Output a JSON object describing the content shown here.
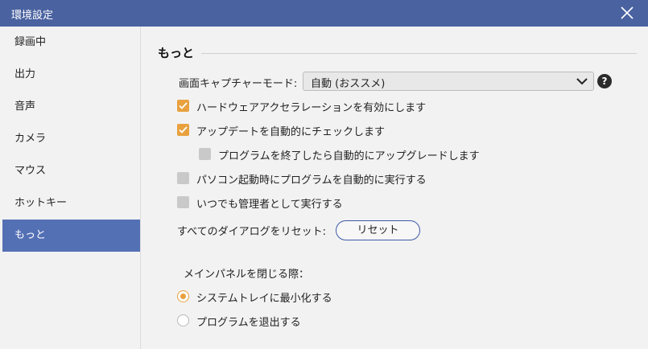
{
  "window": {
    "title": "環境設定"
  },
  "sidebar": {
    "items": [
      {
        "label": "録画中"
      },
      {
        "label": "出力"
      },
      {
        "label": "音声"
      },
      {
        "label": "カメラ"
      },
      {
        "label": "マウス"
      },
      {
        "label": "ホットキー"
      },
      {
        "label": "もっと",
        "active": true
      }
    ]
  },
  "main": {
    "section_title": "もっと",
    "capture_mode": {
      "label": "画面キャプチャーモード:",
      "value": "自動 (おススメ)",
      "help": "?"
    },
    "options": [
      {
        "label": "ハードウェアアクセラレーションを有効にします",
        "checked": true
      },
      {
        "label": "アップデートを自動的にチェックします",
        "checked": true
      },
      {
        "label": "プログラムを終了したら自動的にアップグレードします",
        "checked": false
      },
      {
        "label": "パソコン起動時にプログラムを自動的に実行する",
        "checked": false
      },
      {
        "label": "いつでも管理者として実行する",
        "checked": false
      }
    ],
    "reset": {
      "label": "すべてのダイアログをリセット:",
      "button": "リセット"
    },
    "close_panel": {
      "label": "メインパネルを閉じる際：",
      "choices": [
        {
          "label": "システムトレイに最小化する",
          "selected": true
        },
        {
          "label": "プログラムを退出する",
          "selected": false
        }
      ]
    }
  },
  "colors": {
    "titlebar": "#4a62a0",
    "active_item": "#5470b5",
    "accent": "#e8a13e",
    "button_border": "#3e5aa8"
  }
}
